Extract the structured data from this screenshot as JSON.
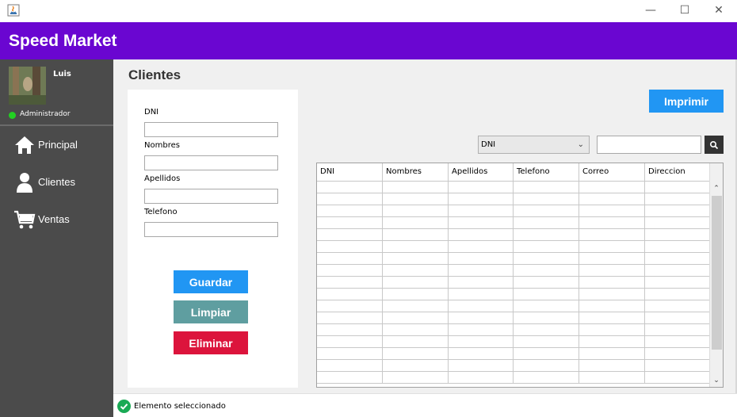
{
  "window": {
    "title": "",
    "minimize_icon": "minimize-icon",
    "maximize_icon": "maximize-icon",
    "close_icon": "close-icon"
  },
  "app": {
    "title": "Speed Market",
    "accent": "#6a06d1"
  },
  "user": {
    "name": "Luis",
    "role": "Administrador",
    "status_color": "#22d022"
  },
  "sidebar": {
    "items": [
      {
        "label": "Principal",
        "icon": "home-icon"
      },
      {
        "label": "Clientes",
        "icon": "user-icon"
      },
      {
        "label": "Ventas",
        "icon": "cart-icon"
      }
    ]
  },
  "page": {
    "title": "Clientes"
  },
  "form": {
    "fields": [
      {
        "label": "DNI",
        "value": ""
      },
      {
        "label": "Nombres",
        "value": ""
      },
      {
        "label": "Apellidos",
        "value": ""
      },
      {
        "label": "Telefono",
        "value": ""
      }
    ],
    "buttons": [
      {
        "label": "Guardar",
        "color": "#2196f3"
      },
      {
        "label": "Limpiar",
        "color": "#5f9ea0"
      },
      {
        "label": "Eliminar",
        "color": "#dc143c"
      }
    ]
  },
  "toolbar": {
    "print_label": "Imprimir",
    "print_color": "#2196f3"
  },
  "search": {
    "filter_value": "DNI",
    "query": ""
  },
  "table": {
    "columns": [
      "DNI",
      "Nombres",
      "Apellidos",
      "Telefono",
      "Correo",
      "Direccion"
    ],
    "rows": []
  },
  "status": {
    "text": "Elemento seleccionado",
    "icon": "check-circle-icon",
    "color": "#1aaa55"
  }
}
